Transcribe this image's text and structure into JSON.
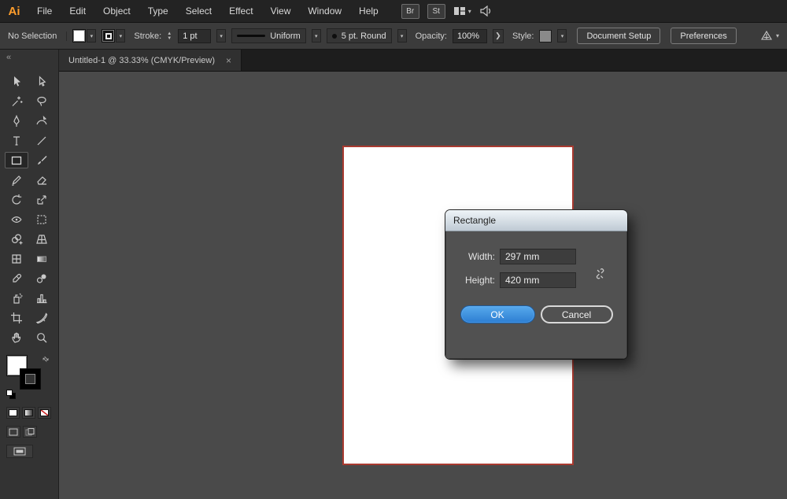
{
  "menubar": {
    "logo": "Ai",
    "items": [
      "File",
      "Edit",
      "Object",
      "Type",
      "Select",
      "Effect",
      "View",
      "Window",
      "Help"
    ],
    "badges": [
      "Br",
      "St"
    ],
    "icons": [
      "arrange-documents-icon",
      "share-icon"
    ]
  },
  "optionsbar": {
    "selection_status": "No Selection",
    "stroke_label": "Stroke:",
    "stroke_weight": "1 pt",
    "width_profile": "Uniform",
    "brush_definition": "5 pt. Round",
    "opacity_label": "Opacity:",
    "opacity_value": "100%",
    "style_label": "Style:",
    "buttons": {
      "document_setup": "Document Setup",
      "preferences": "Preferences"
    }
  },
  "document_tab": {
    "title": "Untitled-1 @ 33.33% (CMYK/Preview)",
    "close_icon": "×"
  },
  "toolbar": {
    "collapse_icon": "«",
    "tools": [
      {
        "name": "selection-tool"
      },
      {
        "name": "direct-selection-tool"
      },
      {
        "name": "magic-wand-tool"
      },
      {
        "name": "lasso-tool"
      },
      {
        "name": "pen-tool"
      },
      {
        "name": "curvature-tool"
      },
      {
        "name": "type-tool"
      },
      {
        "name": "line-segment-tool"
      },
      {
        "name": "rectangle-tool",
        "selected": true
      },
      {
        "name": "paintbrush-tool"
      },
      {
        "name": "shaper-tool"
      },
      {
        "name": "eraser-tool"
      },
      {
        "name": "rotate-tool"
      },
      {
        "name": "scale-tool"
      },
      {
        "name": "width-tool"
      },
      {
        "name": "free-transform-tool"
      },
      {
        "name": "shape-builder-tool"
      },
      {
        "name": "perspective-grid-tool"
      },
      {
        "name": "mesh-tool"
      },
      {
        "name": "gradient-tool"
      },
      {
        "name": "eyedropper-tool"
      },
      {
        "name": "blend-tool"
      },
      {
        "name": "symbol-sprayer-tool"
      },
      {
        "name": "column-graph-tool"
      },
      {
        "name": "artboard-tool"
      },
      {
        "name": "slice-tool"
      },
      {
        "name": "hand-tool"
      },
      {
        "name": "zoom-tool"
      }
    ],
    "swap_icon": "⇄"
  },
  "dialog": {
    "title": "Rectangle",
    "fields": [
      {
        "label": "Width:",
        "value": "297 mm"
      },
      {
        "label": "Height:",
        "value": "420 mm"
      }
    ],
    "constrain_icon": "constrain-proportions-broken-link-icon",
    "buttons": {
      "ok": "OK",
      "cancel": "Cancel"
    }
  },
  "colors": {
    "accent_blue": "#3f97e6",
    "selection_red": "#a93a30",
    "canvas_gray": "#4a4a4a",
    "panel_gray": "#333333",
    "dialog_gray": "#515151",
    "logo_orange": "#ff9e2c"
  }
}
